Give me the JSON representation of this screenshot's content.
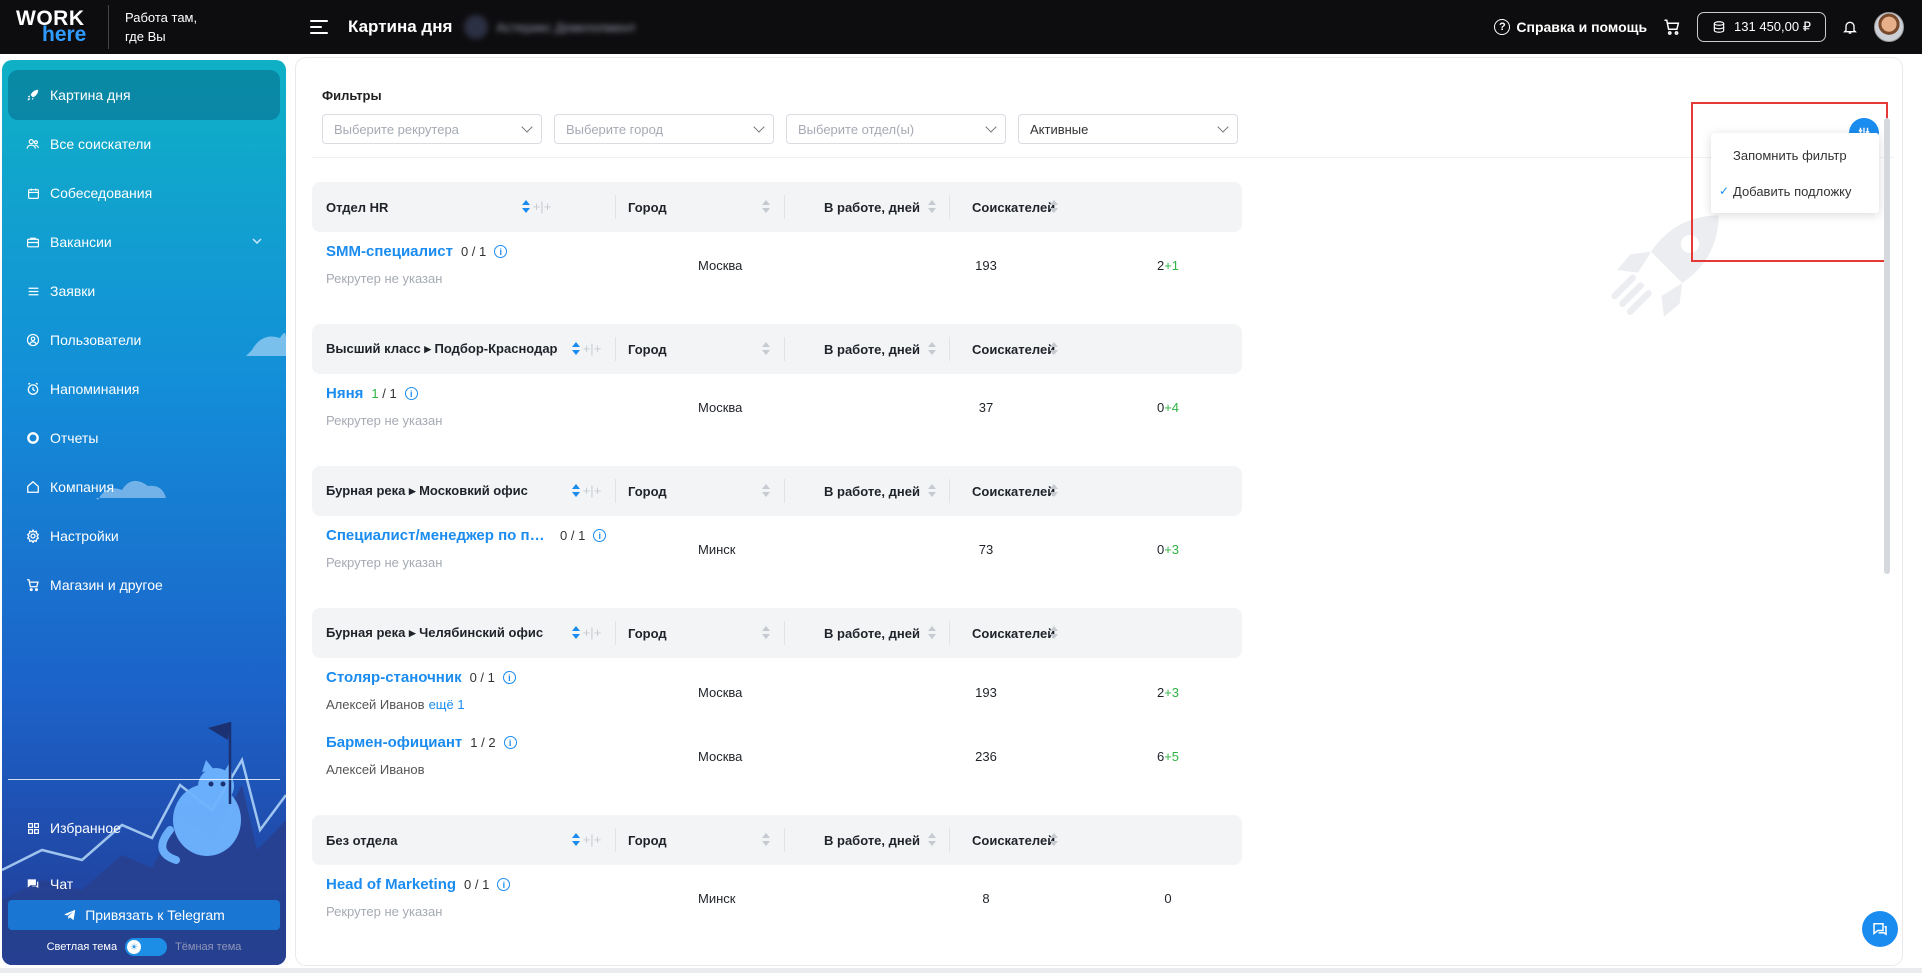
{
  "topbar": {
    "logo_top": "WORK",
    "logo_bottom": "here",
    "slogan_line1": "Работа там,",
    "slogan_line2": "где Вы",
    "page_title": "Картина дня",
    "company_name": "Астерикс Девелопмент",
    "help_label": "Справка и помощь",
    "balance": "131 450,00 ₽"
  },
  "sidebar": {
    "items": [
      {
        "label": "Картина дня",
        "icon": "rocket-icon",
        "active": true
      },
      {
        "label": "Все соискатели",
        "icon": "people-icon"
      },
      {
        "label": "Собеседования",
        "icon": "calendar-icon"
      },
      {
        "label": "Вакансии",
        "icon": "briefcase-icon",
        "has_submenu": true
      },
      {
        "label": "Заявки",
        "icon": "list-icon"
      },
      {
        "label": "Пользователи",
        "icon": "user-circle-icon"
      },
      {
        "label": "Напоминания",
        "icon": "alarm-icon"
      },
      {
        "label": "Отчеты",
        "icon": "donut-chart-icon"
      },
      {
        "label": "Компания",
        "icon": "home-icon"
      },
      {
        "label": "Настройки",
        "icon": "gear-icon"
      },
      {
        "label": "Магазин и другое",
        "icon": "cart-icon"
      },
      {
        "label": "Избранное",
        "icon": "grid-icon"
      },
      {
        "label": "Чат",
        "icon": "chat-icon"
      }
    ],
    "telegram_button": "Привязать к Telegram",
    "theme_light": "Светлая тема",
    "theme_dark": "Тёмная тема"
  },
  "filters": {
    "title": "Фильтры",
    "recruiter_placeholder": "Выберите рекрутера",
    "city_placeholder": "Выберите город",
    "department_placeholder": "Выберите отдел(ы)",
    "status_value": "Активные",
    "menu": {
      "remember": "Запомнить фильтр",
      "add_overlay": "Добавить подложку",
      "add_overlay_checked": true
    }
  },
  "columns": {
    "city": "Город",
    "days": "В работе, дней",
    "candidates": "Соискателей"
  },
  "groups": [
    {
      "department": "Отдел HR",
      "rows": [
        {
          "title": "SMM-специалист",
          "count": "0 / 1",
          "count_green": false,
          "sub": "Рекрутер не указан",
          "sub_person": false,
          "city": "Москва",
          "days": "193",
          "cand": "2",
          "cand_new": "+1"
        }
      ]
    },
    {
      "department": "Высший класс ▸ Подбор-Краснодар",
      "rows": [
        {
          "title": "Няня",
          "count_highlight": "1",
          "count_rest": " / 1",
          "count_green": true,
          "sub": "Рекрутер не указан",
          "sub_person": false,
          "city": "Москва",
          "days": "37",
          "cand": "0",
          "cand_new": "+4"
        }
      ]
    },
    {
      "department": "Бурная река ▸ Московкий офис",
      "rows": [
        {
          "title": "Специалист/менеджер по продажам",
          "count": "0 / 1",
          "count_green": false,
          "sub": "Рекрутер не указан",
          "sub_person": false,
          "city": "Минск",
          "days": "73",
          "cand": "0",
          "cand_new": "+3"
        }
      ]
    },
    {
      "department": "Бурная река ▸ Челябинский офис",
      "rows": [
        {
          "title": "Столяр-станочник",
          "count": "0 / 1",
          "count_green": false,
          "sub": "Алексей Иванов",
          "sub_more": "ещё 1",
          "sub_person": true,
          "city": "Москва",
          "days": "193",
          "cand": "2",
          "cand_new": "+3"
        },
        {
          "title": "Бармен-официант",
          "count": "1 / 2",
          "count_green": false,
          "sub": "Алексей Иванов",
          "sub_person": true,
          "city": "Москва",
          "days": "236",
          "cand": "6",
          "cand_new": "+5"
        }
      ]
    },
    {
      "department": "Без отдела",
      "rows": [
        {
          "title": "Head of Marketing",
          "count": "0 / 1",
          "count_green": false,
          "sub": "Рекрутер не указан",
          "sub_person": false,
          "city": "Минск",
          "days": "8",
          "cand": "0",
          "cand_new": ""
        }
      ]
    }
  ],
  "colors": {
    "accent": "#1a8cf0",
    "positive": "#2fb344",
    "topbar": "#0d0d0f",
    "highlight": "#e53935"
  }
}
